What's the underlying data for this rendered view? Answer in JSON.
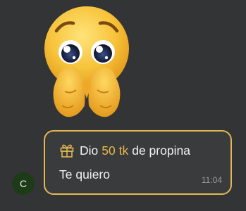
{
  "chat": {
    "sender_initial": "C",
    "gift_message": {
      "prefix": "Dio",
      "amount": "50 tk",
      "suffix": "de propina",
      "text": "Te quiero",
      "timestamp": "11:04"
    },
    "sticker": {
      "icon": "pleading-face-emoji",
      "description": "Pleading face emoji holding hands"
    }
  },
  "colors": {
    "background": "#323436",
    "bubble_border": "#e2b852",
    "amount_accent": "#e8b84c",
    "avatar_bg": "#1e3b18"
  }
}
